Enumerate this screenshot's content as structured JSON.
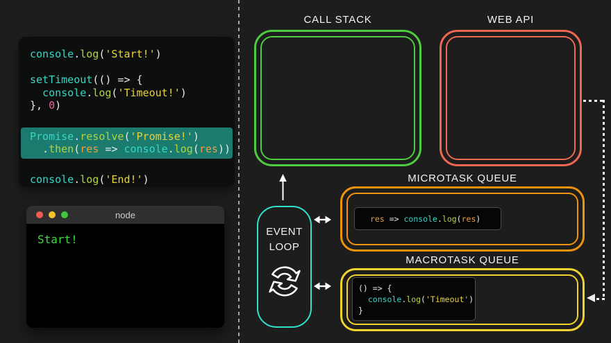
{
  "colors": {
    "page_bg": "#1d1d1d",
    "editor_bg": "#0c0f0e",
    "highlight": "#1a7b6e",
    "terminal_bg": "#000000",
    "titlebar_bg": "#2f2f2f",
    "titlebar_text": "#cdcdcd",
    "chip_bg": "#060606",
    "chip_border": "#4a4a4a",
    "callstack": "#4ecb3e",
    "webapi": "#ee6852",
    "eventloop": "#30e1cc",
    "microtask": "#f0930c",
    "macrotask": "#efd32f",
    "label_text": "#f2f2f2",
    "divider": "#a8a8a8",
    "connector": "#ededed",
    "ident": "#36d7c7",
    "method": "#b4d43e",
    "string": "#e9d23c",
    "number": "#ee5fa0",
    "param": "#ef9d3d",
    "punct": "#eaeaea",
    "terminal_green": "#3bdc3f",
    "traffic_red": "#ef5a52",
    "traffic_yellow": "#f6c22d",
    "traffic_green": "#3fc63e"
  },
  "editor": {
    "lines": [
      {
        "tokens": [
          [
            "ident",
            "console"
          ],
          [
            "punct",
            "."
          ],
          [
            "method",
            "log"
          ],
          [
            "punct",
            "("
          ],
          [
            "string",
            "'Start!'"
          ],
          [
            "punct",
            ")"
          ]
        ]
      },
      {
        "tokens": []
      },
      {
        "tokens": [
          [
            "ident",
            "setTimeout"
          ],
          [
            "punct",
            "(() => {"
          ]
        ]
      },
      {
        "tokens": [
          [
            "punct",
            "  "
          ],
          [
            "ident",
            "console"
          ],
          [
            "punct",
            "."
          ],
          [
            "method",
            "log"
          ],
          [
            "punct",
            "("
          ],
          [
            "string",
            "'Timeout!'"
          ],
          [
            "punct",
            ")"
          ]
        ]
      },
      {
        "tokens": [
          [
            "punct",
            "}, "
          ],
          [
            "number",
            "0"
          ],
          [
            "punct",
            ")"
          ]
        ]
      },
      {
        "tokens": []
      },
      {
        "hl": true,
        "tokens": [
          [
            "ident",
            "Promise"
          ],
          [
            "punct",
            "."
          ],
          [
            "method",
            "resolve"
          ],
          [
            "punct",
            "("
          ],
          [
            "string",
            "'Promise!'"
          ],
          [
            "punct",
            ")"
          ]
        ]
      },
      {
        "hl": true,
        "tokens": [
          [
            "punct",
            "  ."
          ],
          [
            "method",
            "then"
          ],
          [
            "punct",
            "("
          ],
          [
            "param",
            "res"
          ],
          [
            "punct",
            " => "
          ],
          [
            "ident",
            "console"
          ],
          [
            "punct",
            "."
          ],
          [
            "method",
            "log"
          ],
          [
            "punct",
            "("
          ],
          [
            "param",
            "res"
          ],
          [
            "punct",
            "))"
          ]
        ]
      },
      {
        "tokens": []
      },
      {
        "tokens": [
          [
            "ident",
            "console"
          ],
          [
            "punct",
            "."
          ],
          [
            "method",
            "log"
          ],
          [
            "punct",
            "("
          ],
          [
            "string",
            "'End!'"
          ],
          [
            "punct",
            ")"
          ]
        ]
      }
    ]
  },
  "terminal": {
    "title": "node",
    "output": "Start!"
  },
  "diagram": {
    "call_stack": {
      "label": "CALL STACK"
    },
    "web_api": {
      "label": "WEB API"
    },
    "event_loop": {
      "line1": "EVENT",
      "line2": "LOOP",
      "icon": "refresh-cycle-icon"
    },
    "microtask_queue": {
      "label": "MICROTASK QUEUE",
      "code": [
        {
          "tokens": [
            [
              "param",
              "res"
            ],
            [
              "punct",
              " => "
            ],
            [
              "ident",
              "console"
            ],
            [
              "punct",
              "."
            ],
            [
              "method",
              "log"
            ],
            [
              "punct",
              "("
            ],
            [
              "param",
              "res"
            ],
            [
              "punct",
              ")"
            ]
          ]
        }
      ]
    },
    "macrotask_queue": {
      "label": "MACROTASK QUEUE",
      "code": [
        {
          "tokens": [
            [
              "punct",
              "() => {"
            ]
          ]
        },
        {
          "tokens": [
            [
              "punct",
              "  "
            ],
            [
              "ident",
              "console"
            ],
            [
              "punct",
              "."
            ],
            [
              "method",
              "log"
            ],
            [
              "punct",
              "("
            ],
            [
              "string",
              "'Timeout'"
            ],
            [
              "punct",
              ")"
            ]
          ]
        },
        {
          "tokens": [
            [
              "punct",
              "}"
            ]
          ]
        }
      ]
    },
    "icons": {
      "event_loop_to_callstack": "arrow-up",
      "event_loop_to_queues": "arrow-left-right",
      "webapi_to_macrotask": "dashed-arrow-left"
    }
  }
}
